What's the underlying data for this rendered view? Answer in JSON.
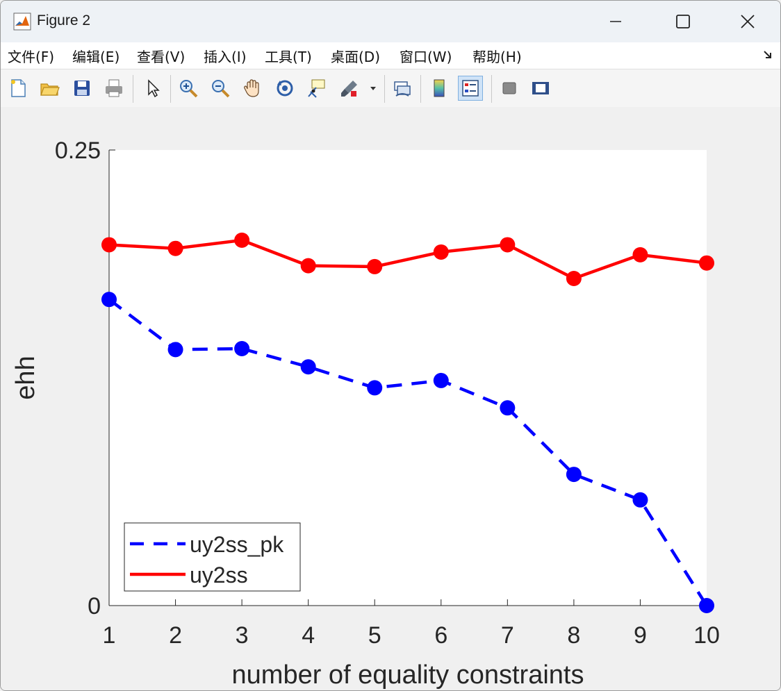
{
  "window": {
    "title": "Figure 2",
    "icon": "matlab-logo-icon"
  },
  "menu": {
    "items": [
      {
        "label": "文件(F)"
      },
      {
        "label": "编辑(E)"
      },
      {
        "label": "查看(V)"
      },
      {
        "label": "插入(I)"
      },
      {
        "label": "工具(T)"
      },
      {
        "label": "桌面(D)"
      },
      {
        "label": "窗口(W)"
      },
      {
        "label": "帮助(H)"
      }
    ]
  },
  "toolbar": {
    "buttons": [
      "new-figure-icon",
      "open-file-icon",
      "save-icon",
      "print-icon",
      "select-arrow-icon",
      "zoom-in-icon",
      "zoom-out-icon",
      "pan-hand-icon",
      "rotate-3d-icon",
      "data-cursor-icon",
      "brush-icon",
      "link-plot-icon",
      "colorbar-icon",
      "legend-icon",
      "hide-plot-tools-icon",
      "show-plot-tools-icon"
    ],
    "active": "legend-icon"
  },
  "chart_data": {
    "type": "line",
    "title": "",
    "xlabel": "number of equality constraints",
    "ylabel": "ehh",
    "x": [
      1,
      2,
      3,
      4,
      5,
      6,
      7,
      8,
      9,
      10
    ],
    "xlim": [
      1,
      10
    ],
    "ylim": [
      0,
      0.25
    ],
    "x_ticks": [
      "1",
      "2",
      "3",
      "4",
      "5",
      "6",
      "7",
      "8",
      "9",
      "10"
    ],
    "y_ticks": [
      "0",
      "0.25"
    ],
    "y_tick_values": [
      0,
      0.25
    ],
    "grid": false,
    "legend_position": "bottom-left",
    "series": [
      {
        "name": "uy2ss_pk",
        "color": "#0000ff",
        "line_style": "dashed",
        "marker": "circle",
        "values": [
          0.168,
          0.1405,
          0.141,
          0.131,
          0.1195,
          0.1235,
          0.1085,
          0.072,
          0.058,
          0.0
        ]
      },
      {
        "name": "uy2ss",
        "color": "#ff0000",
        "line_style": "solid",
        "marker": "circle",
        "values": [
          0.198,
          0.196,
          0.2005,
          0.1865,
          0.186,
          0.194,
          0.198,
          0.1795,
          0.1925,
          0.188
        ]
      }
    ]
  }
}
